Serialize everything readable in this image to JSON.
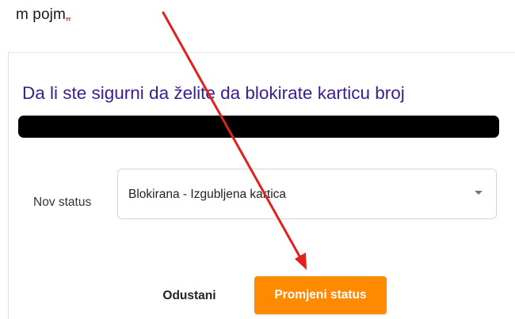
{
  "caption": {
    "text": "m pojm",
    "quote_mark": "„"
  },
  "dialog": {
    "title": "Da li ste sigurni da želite da blokirate karticu broj",
    "card_number_redacted": true,
    "status_field": {
      "label": "Nov status",
      "selected_value": "Blokirana - Izgubljena kartica"
    },
    "buttons": {
      "cancel_label": "Odustani",
      "confirm_label": "Promjeni status"
    }
  },
  "colors": {
    "title": "#3b1d8f",
    "confirm_button": "#ff8a00",
    "annotation_arrow": "#e0211c",
    "redaction": "#000000"
  },
  "icons": {
    "select_caret": "caret-down-icon",
    "annotation": "red-arrow-icon"
  }
}
